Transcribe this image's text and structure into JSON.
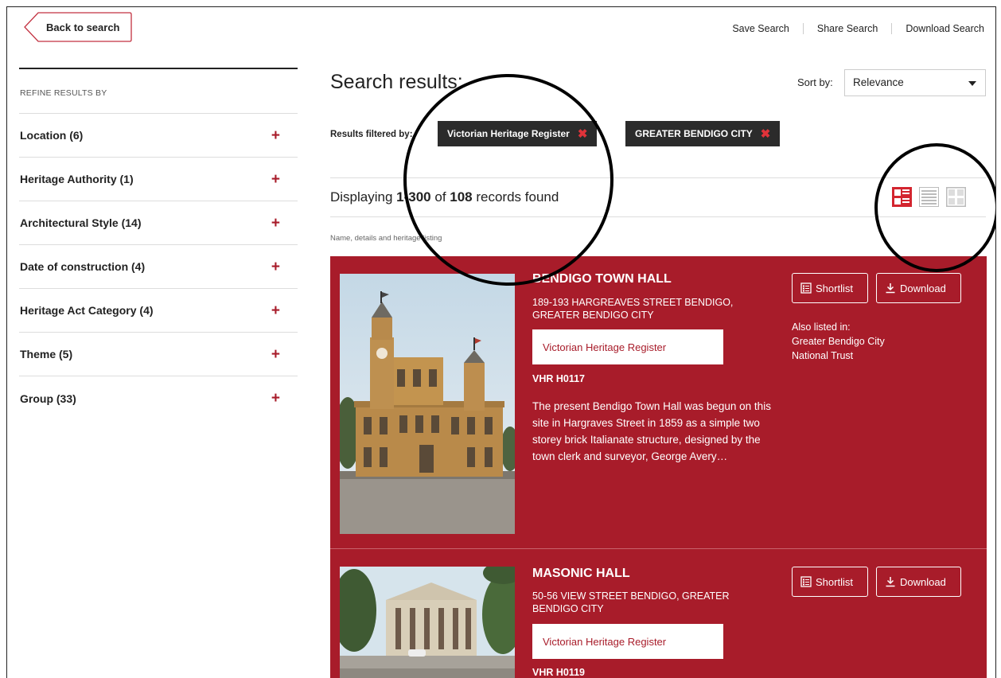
{
  "header": {
    "back_label": "Back to search",
    "links": [
      "Save Search",
      "Share Search",
      "Download Search"
    ]
  },
  "sidebar": {
    "heading": "REFINE RESULTS BY",
    "facets": [
      {
        "label": "Location (6)"
      },
      {
        "label": "Heritage Authority (1)"
      },
      {
        "label": "Architectural Style (14)"
      },
      {
        "label": "Date of construction (4)"
      },
      {
        "label": "Heritage Act Category (4)"
      },
      {
        "label": "Theme (5)"
      },
      {
        "label": "Group (33)"
      }
    ],
    "expand_glyph": "+"
  },
  "main": {
    "title": "Search results:",
    "sort_label": "Sort by:",
    "sort_value": "Relevance",
    "filtered_label": "Results filtered by:",
    "chips": [
      {
        "label": "Victorian Heritage Register"
      },
      {
        "label": "GREATER BENDIGO CITY"
      }
    ],
    "count_prefix": "Displaying ",
    "count_range": "1-300",
    "count_mid": " of ",
    "count_total": "108",
    "count_suffix": " records found",
    "column_caption": "Name, details and heritage listing",
    "view_icons": [
      "grid-list-icon",
      "list-view-icon",
      "tile-view-icon"
    ],
    "accent_color": "#a81c2a"
  },
  "results": [
    {
      "name": "BENDIGO TOWN HALL",
      "address": "189-193 HARGREAVES STREET BENDIGO, GREATER BENDIGO CITY",
      "register": "Victorian Heritage Register",
      "vhr": "VHR H0117",
      "description": "The present Bendigo Town Hall was begun on this site in Hargraves Street in 1859 as a simple two storey brick Italianate structure, designed by the town clerk and surveyor, George Avery…",
      "shortlist_label": "Shortlist",
      "download_label": "Download",
      "also_listed_heading": "Also listed in:",
      "also_listed": [
        "Greater Bendigo City",
        "National Trust"
      ]
    },
    {
      "name": "MASONIC HALL",
      "address": "50-56 VIEW STREET BENDIGO, GREATER BENDIGO CITY",
      "register": "Victorian Heritage Register",
      "vhr": "VHR H0119",
      "shortlist_label": "Shortlist",
      "download_label": "Download"
    }
  ]
}
